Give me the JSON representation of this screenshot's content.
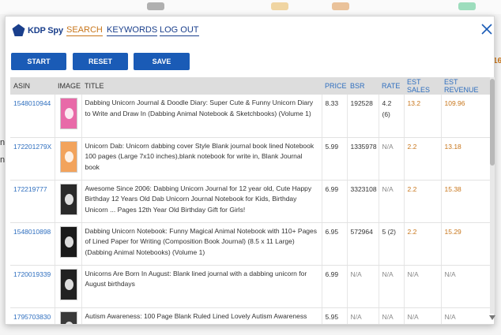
{
  "app": {
    "logo_text": "KDP Spy",
    "nav": [
      {
        "label": "SEARCH",
        "active": true
      },
      {
        "label": "KEYWORDS",
        "active": false
      },
      {
        "label": "LOG OUT",
        "active": false
      }
    ],
    "side_count": "16",
    "side_fragments": [
      "n",
      "n"
    ]
  },
  "toolbar": {
    "start_label": "START",
    "reset_label": "RESET",
    "save_label": "SAVE"
  },
  "table": {
    "headers": [
      "ASIN",
      "IMAGE",
      "TITLE",
      "PRICE",
      "BSR",
      "RATE",
      "EST SALES",
      "EST REVENUE"
    ],
    "rows": [
      {
        "asin": "1548010944",
        "cover_color": "#e86aa8",
        "title": "Dabbing Unicorn Journal & Doodle Diary: Super Cute & Funny Unicorn Diary to Write and Draw In (Dabbing Animal Notebook & Sketchbooks) (Volume 1)",
        "price": "8.33",
        "bsr": "192528",
        "rate": "4.2 (6)",
        "sales": "13.2",
        "revenue": "109.96"
      },
      {
        "asin": "172201279X",
        "cover_color": "#f2a35c",
        "title": "Unicorn Dab: Unicorn dabbing cover Style Blank journal book lined Notebook 100 pages (Large 7x10 inches),blank notebook for write in, Blank Journal book",
        "price": "5.99",
        "bsr": "1335978",
        "rate": "N/A",
        "sales": "2.2",
        "revenue": "13.18"
      },
      {
        "asin": "172219777",
        "cover_color": "#2a2a2a",
        "title": "Awesome Since 2006: Dabbing Unicorn Journal for 12 year old, Cute Happy Birthday 12 Years Old Dab Unicorn Journal Notebook for Kids, Birthday Unicorn ... Pages 12th Year Old Birthday Gift for Girls!",
        "price": "6.99",
        "bsr": "3323108",
        "rate": "N/A",
        "sales": "2.2",
        "revenue": "15.38"
      },
      {
        "asin": "1548010898",
        "cover_color": "#1a1a1a",
        "title": "Dabbing Unicorn Notebook: Funny Magical Animal Notebook with 110+ Pages of Lined Paper for Writing (Composition Book Journal) (8.5 x 11 Large) (Dabbing Animal Notebooks) (Volume 1)",
        "price": "6.95",
        "bsr": "572964",
        "rate": "5 (2)",
        "sales": "2.2",
        "revenue": "15.29"
      },
      {
        "asin": "1720019339",
        "cover_color": "#222222",
        "title": "Unicorns Are Born In August: Blank lined journal with a dabbing unicorn for August birthdays",
        "price": "6.99",
        "bsr": "N/A",
        "rate": "N/A",
        "sales": "N/A",
        "revenue": "N/A"
      },
      {
        "asin": "1795703830",
        "cover_color": "#3a3a3a",
        "title": "Autism Awareness: 100 Page Blank Ruled Lined Lovely Autism Awareness",
        "price": "5.95",
        "bsr": "N/A",
        "rate": "N/A",
        "sales": "N/A",
        "revenue": "N/A"
      }
    ]
  },
  "colors": {
    "brand": "#1a3f8c",
    "accent": "#c8761b",
    "button": "#1a5bb6",
    "link": "#2f6fbf"
  },
  "icons": {
    "logo": "pentagon-logo-icon",
    "close": "close-icon"
  }
}
